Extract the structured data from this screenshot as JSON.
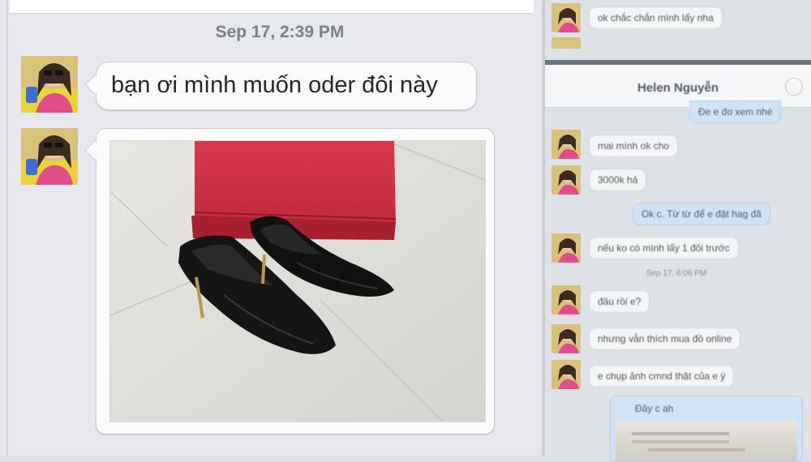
{
  "left": {
    "timestamp": "Sep 17, 2:39 PM",
    "messages": [
      {
        "text": "bạn ơi mình muốn oder đôi này"
      },
      {
        "type": "photo",
        "subject": "black pointed heels with red box"
      }
    ]
  },
  "right": {
    "contact_name": "Helen Nguyễn",
    "messages": [
      {
        "from": "them",
        "text": "ok chắc chắn mình lấy nha"
      },
      {
        "from": "me",
        "text": "Đe e đo xem nhé"
      },
      {
        "from": "them",
        "text": "mai mình ok cho"
      },
      {
        "from": "them",
        "text": "3000k hả"
      },
      {
        "from": "me",
        "text": "Ok c. Từ từ để e đặt hag đã"
      },
      {
        "from": "them",
        "text": "nếu ko có mình lấy 1 đôi trước"
      },
      {
        "from": "them",
        "text": "đâu rồi e?"
      },
      {
        "from": "them",
        "text": "nhưng vẫn thích mua đồ online"
      },
      {
        "from": "them",
        "text": "e chụp ảnh cmnd thật của e ý"
      },
      {
        "from": "me",
        "text": "Đây c ah"
      }
    ],
    "timestamp": "Sep 17, 6:06 PM"
  },
  "colors": {
    "bubble_incoming": "#fbfbfc",
    "bubble_outgoing": "#cfe3f5",
    "background": "#e6e8ed"
  },
  "icons": {
    "avatar": "avatar-photo",
    "info": "info-icon"
  }
}
